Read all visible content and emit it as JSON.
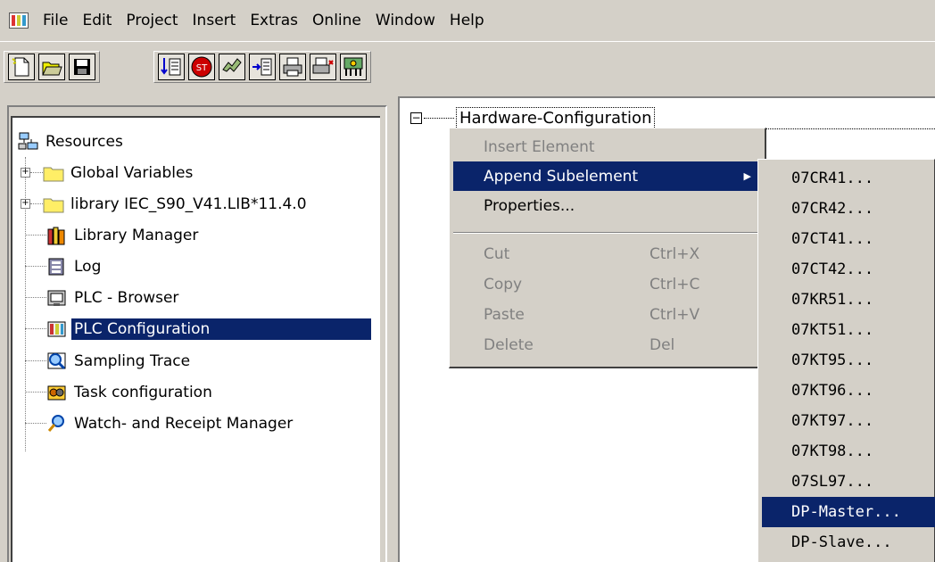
{
  "menubar": {
    "items": [
      "File",
      "Edit",
      "Project",
      "Insert",
      "Extras",
      "Online",
      "Window",
      "Help"
    ]
  },
  "toolbar": {
    "buttons": [
      "new-icon",
      "open-icon",
      "save-icon",
      "download-icon",
      "stop-icon",
      "run-icon",
      "step-icon",
      "print-icon",
      "print-preview-icon",
      "hardware-icon"
    ]
  },
  "resources_tree": {
    "root": "Resources",
    "items": [
      {
        "label": "Global Variables",
        "icon": "folder-icon",
        "expandable": true
      },
      {
        "label": "library IEC_S90_V41.LIB*11.4.0",
        "icon": "folder-icon",
        "expandable": true
      },
      {
        "label": "Library Manager",
        "icon": "books-icon"
      },
      {
        "label": "Log",
        "icon": "log-icon"
      },
      {
        "label": "PLC - Browser",
        "icon": "browser-icon"
      },
      {
        "label": "PLC Configuration",
        "icon": "plc-config-icon",
        "selected": true
      },
      {
        "label": "Sampling Trace",
        "icon": "magnifier-chart-icon"
      },
      {
        "label": "Task configuration",
        "icon": "task-icon"
      },
      {
        "label": "Watch- and Receipt Manager",
        "icon": "magnifier-icon"
      }
    ]
  },
  "config_tree": {
    "root": "Hardware-Configuration"
  },
  "context_menu": {
    "items": [
      {
        "label": "Insert Element",
        "disabled": true
      },
      {
        "label": "Append Subelement",
        "highlighted": true,
        "has_submenu": true
      },
      {
        "label": "Properties..."
      }
    ],
    "edit_items": [
      {
        "label": "Cut",
        "shortcut": "Ctrl+X",
        "disabled": true
      },
      {
        "label": "Copy",
        "shortcut": "Ctrl+C",
        "disabled": true
      },
      {
        "label": "Paste",
        "shortcut": "Ctrl+V",
        "disabled": true
      },
      {
        "label": "Delete",
        "shortcut": "Del",
        "disabled": true
      }
    ]
  },
  "submenu": {
    "items": [
      {
        "label": "07CR41..."
      },
      {
        "label": "07CR42..."
      },
      {
        "label": "07CT41..."
      },
      {
        "label": "07CT42..."
      },
      {
        "label": "07KR51..."
      },
      {
        "label": "07KT51..."
      },
      {
        "label": "07KT95..."
      },
      {
        "label": "07KT96..."
      },
      {
        "label": "07KT97..."
      },
      {
        "label": "07KT98..."
      },
      {
        "label": "07SL97..."
      },
      {
        "label": "DP-Master...",
        "highlighted": true
      },
      {
        "label": "DP-Slave..."
      }
    ]
  },
  "colors": {
    "highlight": "#0a246a",
    "face": "#d4d0c8",
    "disabled_text": "#808080"
  }
}
